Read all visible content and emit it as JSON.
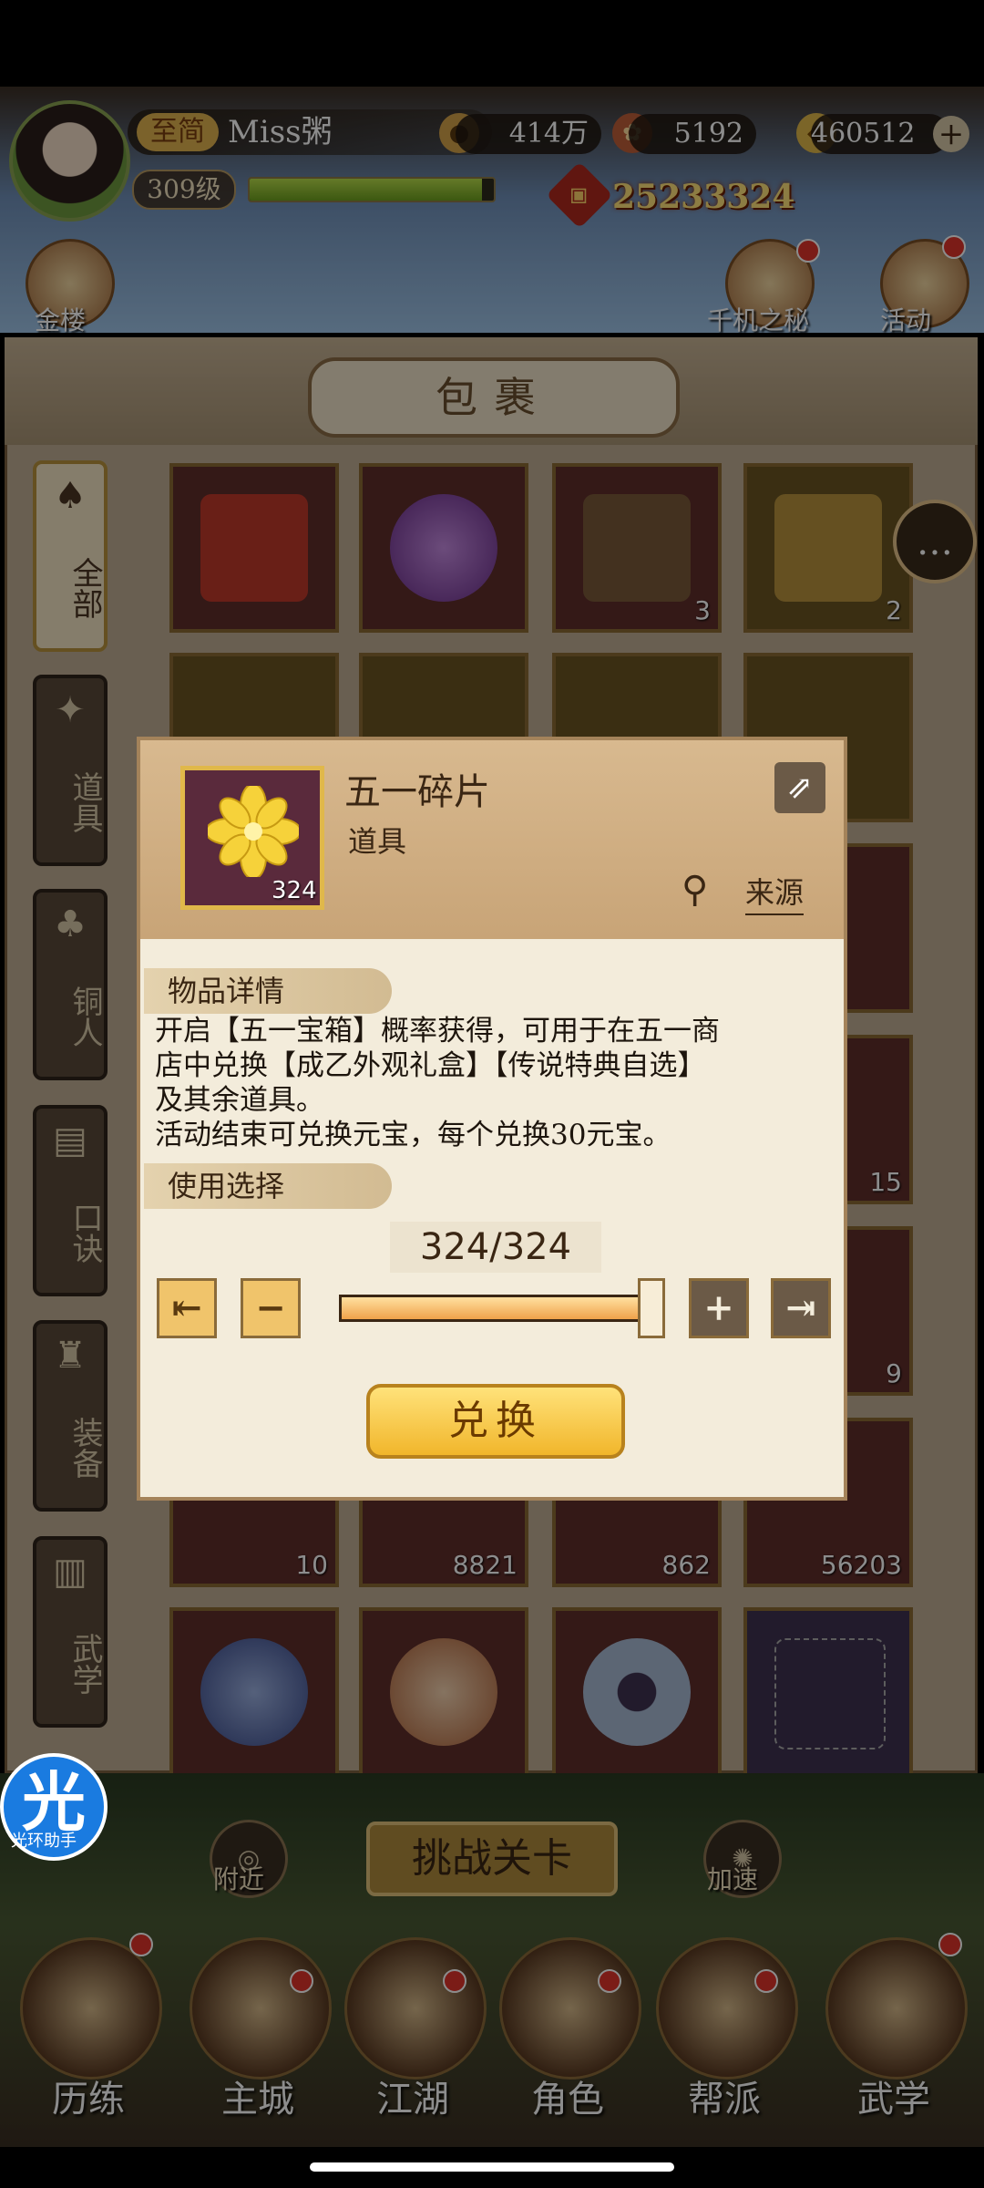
{
  "player": {
    "vip_label": "至简",
    "name": "Miss粥",
    "level": "309级",
    "xp_fraction": 0.95,
    "power": "25233324"
  },
  "resources": [
    {
      "icon": "coin-icon",
      "value": "414万"
    },
    {
      "icon": "ingot-flower-icon",
      "value": "5192"
    },
    {
      "icon": "gold-ingot-icon",
      "value": "460512"
    }
  ],
  "top_side": {
    "left_label": "金楼",
    "right_labels": [
      "千机之秘",
      "活动"
    ]
  },
  "bag": {
    "title": "包裹",
    "tabs": [
      {
        "label": "全部",
        "icon": "fan-icon",
        "active": true
      },
      {
        "label": "道具",
        "icon": "item-icon",
        "active": false
      },
      {
        "label": "铜人",
        "icon": "bronze-figure-icon",
        "active": false
      },
      {
        "label": "口诀",
        "icon": "scroll-icon",
        "active": false
      },
      {
        "label": "装备",
        "icon": "armor-icon",
        "active": false
      },
      {
        "label": "武学",
        "icon": "book-icon",
        "active": false
      }
    ],
    "row1_counts": [
      "",
      "",
      "3",
      "2"
    ],
    "side_counts": [
      "15",
      "9"
    ],
    "row_bottom_counts": [
      "10",
      "8821",
      "862",
      "56203"
    ]
  },
  "modal": {
    "item_name": "五一碎片",
    "item_type": "道具",
    "item_count": "324",
    "source_label": "来源",
    "detail_title": "物品详情",
    "description_lines": [
      "开启【五一宝箱】概率获得，可用于在五一商",
      "店中兑换【成乙外观礼盒】【传说特典自选】",
      "及其余道具。",
      "活动结束可兑换元宝，每个兑换30元宝。"
    ],
    "use_title": "使用选择",
    "quantity": "324/324",
    "slider_fraction": 1.0,
    "exchange_label": "兑换"
  },
  "bottom": {
    "challenge_label": "挑战关卡",
    "nearby_label": "附近",
    "speed_label": "加速",
    "helper_label": "光环助手",
    "helper_glyph": "光",
    "nav": [
      "历练",
      "主城",
      "江湖",
      "角色",
      "帮派",
      "武学"
    ]
  }
}
